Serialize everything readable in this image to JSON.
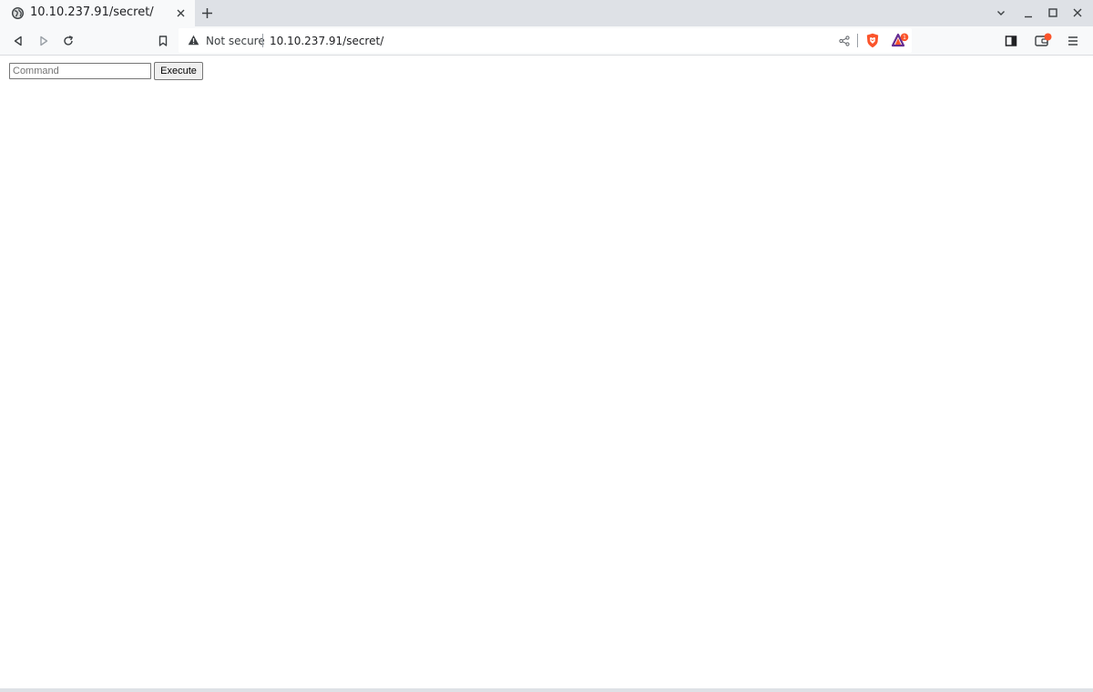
{
  "tab": {
    "title": "10.10.237.91/secret/",
    "favicon": "globe-icon"
  },
  "toolbar": {
    "security_label": "Not secure",
    "url": "10.10.237.91/secret/",
    "rewards_badge": "1"
  },
  "form": {
    "command_placeholder": "Command",
    "command_value": "",
    "execute_label": "Execute"
  },
  "colors": {
    "tabstrip_bg": "#dee1e6",
    "toolbar_bg": "#f8f9fa",
    "brave_orange": "#fb542b",
    "rewards_purple": "#662d91"
  }
}
